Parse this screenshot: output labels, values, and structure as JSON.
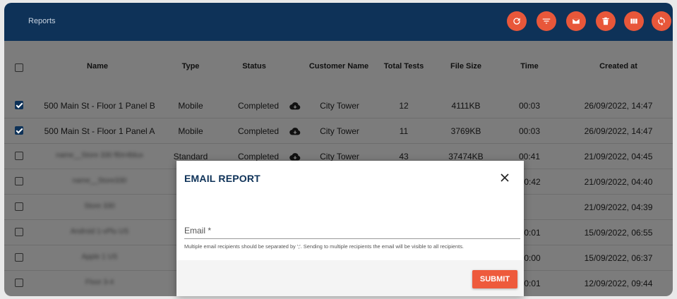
{
  "header": {
    "title": "Reports",
    "actions": [
      {
        "name": "refresh-button",
        "icon": "refresh-icon"
      },
      {
        "name": "filter-button",
        "icon": "filter-icon"
      },
      {
        "name": "email-button",
        "icon": "mail-icon"
      },
      {
        "name": "delete-button",
        "icon": "trash-icon"
      },
      {
        "name": "columns-button",
        "icon": "columns-icon"
      },
      {
        "name": "sync-button",
        "icon": "sync-icon"
      }
    ],
    "accent": "#e8573a",
    "bar_color": "#0e3258"
  },
  "table": {
    "columns": [
      "Name",
      "Type",
      "Status",
      "Customer Name",
      "Total Tests",
      "File Size",
      "Time",
      "Created at"
    ],
    "rows": [
      {
        "checked": true,
        "name": "500 Main St - Floor 1 Panel B",
        "type": "Mobile",
        "status": "Completed",
        "customer": "City Tower",
        "tests": "12",
        "size": "4111KB",
        "time": "00:03",
        "created": "26/09/2022, 14:47",
        "blurred": false
      },
      {
        "checked": true,
        "name": "500 Main St - Floor 1 Panel A",
        "type": "Mobile",
        "status": "Completed",
        "customer": "City Tower",
        "tests": "11",
        "size": "3769KB",
        "time": "00:03",
        "created": "26/09/2022, 14:47",
        "blurred": false
      },
      {
        "checked": false,
        "name": "name__Store 330 fl0rr4blux",
        "type": "Standard",
        "status": "Completed",
        "customer": "City Tower",
        "tests": "43",
        "size": "37474KB",
        "time": "00:41",
        "created": "21/09/2022, 04:45",
        "blurred": true
      },
      {
        "checked": false,
        "name": "name__Store330",
        "type": "S",
        "status": "",
        "customer": "",
        "tests": "",
        "size": "",
        "time": "0:42",
        "created": "21/09/2022, 04:40",
        "blurred": true
      },
      {
        "checked": false,
        "name": "Store 330",
        "type": "S",
        "status": "",
        "customer": "",
        "tests": "",
        "size": "",
        "time": "",
        "created": "21/09/2022, 04:39",
        "blurred": true
      },
      {
        "checked": false,
        "name": "Android 1-vPlu US",
        "type": "",
        "status": "",
        "customer": "",
        "tests": "",
        "size": "",
        "time": "0:01",
        "created": "15/09/2022, 06:55",
        "blurred": true
      },
      {
        "checked": false,
        "name": "Apple 1 US",
        "type": "",
        "status": "",
        "customer": "",
        "tests": "",
        "size": "",
        "time": "0:00",
        "created": "15/09/2022, 06:37",
        "blurred": true
      },
      {
        "checked": false,
        "name": "Floor 3-4",
        "type": "",
        "status": "",
        "customer": "",
        "tests": "",
        "size": "",
        "time": "0:01",
        "created": "12/09/2022, 09:44",
        "blurred": true
      }
    ]
  },
  "modal": {
    "title": "EMAIL REPORT",
    "email_label": "Email *",
    "email_value": "",
    "hint": "Multiple email recipients should be separated by ';'. Sending to multiple recipients the email will be visible to all recipients.",
    "submit_label": "SUBMIT",
    "accent": "#ee5a3c"
  }
}
